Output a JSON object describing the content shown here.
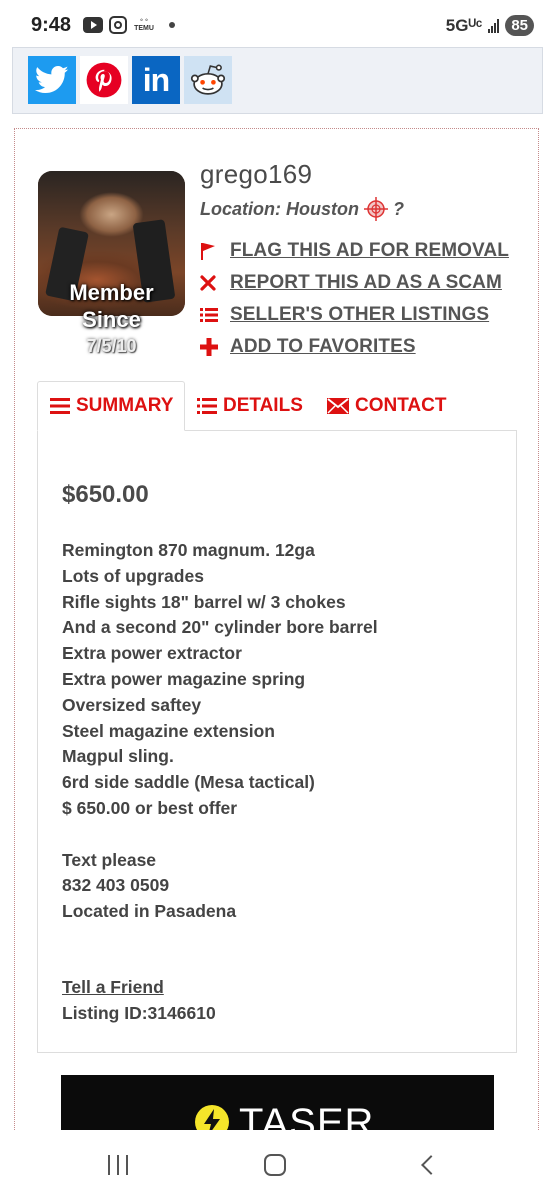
{
  "status_bar": {
    "time": "9:48",
    "temu_label": "TEMU",
    "network": "5Gᵁᶜ",
    "battery": "85"
  },
  "social": {
    "buttons": [
      {
        "name": "twitter",
        "color": "#1d9bf0"
      },
      {
        "name": "pinterest",
        "color": "#e60023"
      },
      {
        "name": "linkedin",
        "label": "in",
        "color": "#0a66c2"
      },
      {
        "name": "reddit",
        "color": "#ff4500"
      }
    ]
  },
  "seller": {
    "username": "grego169",
    "location_label": "Location: Houston",
    "location_suffix": "?",
    "member_since_label": "Member Since",
    "member_since_date": "7/5/10"
  },
  "actions": [
    {
      "label": "FLAG THIS AD FOR REMOVAL",
      "icon": "flag-icon"
    },
    {
      "label": "REPORT THIS AD AS A SCAM",
      "icon": "x-icon"
    },
    {
      "label": "SELLER'S OTHER LISTINGS",
      "icon": "list-icon"
    },
    {
      "label": "ADD TO FAVORITES",
      "icon": "plus-icon"
    }
  ],
  "tabs": [
    {
      "label": "SUMMARY",
      "active": true
    },
    {
      "label": "DETAILS",
      "active": false
    },
    {
      "label": "CONTACT",
      "active": false
    }
  ],
  "listing": {
    "price": "$650.00",
    "description_lines": [
      "Remington 870 magnum. 12ga",
      "Lots of upgrades",
      "Rifle sights 18\" barrel w/ 3 chokes",
      "And a second 20\" cylinder bore barrel",
      "Extra power extractor",
      "Extra power magazine spring",
      "Oversized saftey",
      "Steel magazine extension",
      "Magpul sling.",
      "6rd side saddle (Mesa tactical)",
      "$ 650.00 or best offer",
      "",
      "Text please",
      "832 403 0509",
      "Located in Pasadena"
    ],
    "tell_friend": "Tell a Friend",
    "listing_id": "Listing ID:3146610"
  },
  "ad": {
    "text": "TASER"
  },
  "accent_color": "#dd1111"
}
